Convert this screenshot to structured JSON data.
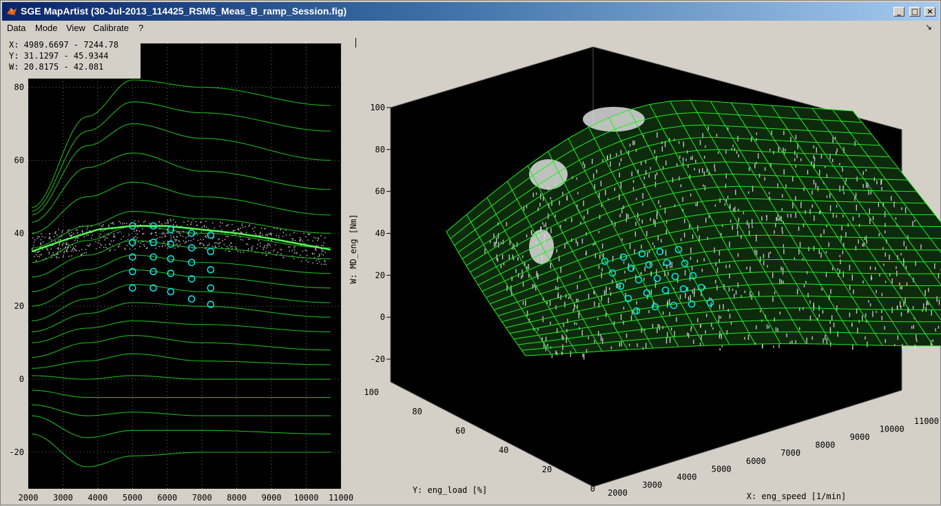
{
  "window": {
    "title": "SGE MapArtist (30-Jul-2013_114425_RSM5_Meas_B_ramp_Session.fig)",
    "buttons": {
      "minimize": "_",
      "maximize": "□",
      "close": "×"
    }
  },
  "menu": [
    "Data",
    "Mode",
    "View",
    "Calibrate",
    "?"
  ],
  "readout": {
    "x": "X: 4989.6697 - 7244.78",
    "y": "Y: 31.1297 - 45.9344",
    "w": "W: 20.8175 - 42.081"
  },
  "colors": {
    "surface": "#22ee22",
    "points": "#ffffff",
    "selection": "#00e5e5",
    "plot_bg": "#000000",
    "window": "#d4d0c8"
  },
  "left_plot": {
    "xticks": [
      "2000",
      "3000",
      "4000",
      "5000",
      "6000",
      "7000",
      "8000",
      "9000",
      "10000",
      "11000"
    ],
    "yticks": [
      "-20",
      "0",
      "20",
      "40",
      "60",
      "80"
    ]
  },
  "right_plot": {
    "zticks": [
      "100",
      "80",
      "60",
      "40",
      "20",
      "0",
      "-20"
    ],
    "yticks": [
      "100",
      "80",
      "60",
      "40",
      "20",
      "0"
    ],
    "xticks": [
      "2000",
      "3000",
      "4000",
      "5000",
      "6000",
      "7000",
      "8000",
      "9000",
      "10000",
      "11000"
    ],
    "zlabel": "W: MD_eng [Nm]",
    "ylabel": "Y: eng_load [%]",
    "xlabel": "X: eng_speed [1/min]"
  },
  "chart_data": [
    {
      "type": "line",
      "title": "",
      "xlabel": "",
      "ylabel": "",
      "xlim": [
        2000,
        11000
      ],
      "ylim": [
        -30,
        92
      ],
      "x": [
        2100,
        3700,
        5000,
        7000,
        10700
      ],
      "series": [
        {
          "values": [
            -15,
            -24,
            -21,
            -20,
            -20
          ]
        },
        {
          "values": [
            -10,
            -16,
            -14,
            -14,
            -15
          ]
        },
        {
          "values": [
            -7,
            -10,
            -9,
            -10,
            -10
          ]
        },
        {
          "values": [
            -3,
            -5,
            -5,
            -5,
            -5
          ]
        },
        {
          "values": [
            1,
            0,
            1,
            0,
            0
          ]
        },
        {
          "values": [
            3,
            5,
            7,
            5,
            4
          ]
        },
        {
          "values": [
            6,
            10,
            12,
            10,
            8
          ]
        },
        {
          "values": [
            10,
            14,
            16,
            15,
            13
          ]
        },
        {
          "values": [
            13,
            18,
            21,
            20,
            17
          ]
        },
        {
          "values": [
            16,
            22,
            26,
            24,
            21
          ]
        },
        {
          "values": [
            20,
            26,
            30,
            28,
            25
          ]
        },
        {
          "values": [
            24,
            30,
            34,
            32,
            29
          ]
        },
        {
          "values": [
            28,
            34,
            38,
            36,
            33
          ]
        },
        {
          "values": [
            32,
            38,
            42,
            40,
            36
          ]
        },
        {
          "values": [
            36,
            42,
            46,
            44,
            40
          ]
        },
        {
          "values": [
            40,
            50,
            54,
            50,
            45
          ]
        },
        {
          "values": [
            43,
            58,
            62,
            57,
            52
          ]
        },
        {
          "values": [
            45,
            64,
            70,
            66,
            60
          ]
        },
        {
          "values": [
            46,
            68,
            76,
            73,
            68
          ]
        },
        {
          "values": [
            47,
            72,
            82,
            80,
            75
          ]
        }
      ],
      "highlight_line": {
        "x": [
          2100,
          3000,
          4000,
          5000,
          6000,
          7000,
          8000,
          9000,
          10700
        ],
        "values": [
          35,
          38,
          41,
          42,
          42,
          41,
          40,
          38.5,
          35.5
        ]
      },
      "selected_points": {
        "x": [
          5000,
          5000,
          5000,
          5000,
          5000,
          5600,
          5600,
          5600,
          5600,
          5600,
          6100,
          6100,
          6100,
          6100,
          6100,
          6700,
          6700,
          6700,
          6700,
          6700,
          7250,
          7250,
          7250,
          7250,
          7250
        ],
        "y": [
          42,
          37.5,
          33.5,
          29.5,
          25,
          42,
          37.5,
          33.5,
          29.5,
          25,
          41,
          37,
          33,
          29,
          24,
          40,
          36,
          32,
          27.5,
          22,
          39.5,
          35,
          30,
          25,
          20.5
        ]
      }
    },
    {
      "type": "surface",
      "title": "",
      "xlabel": "X: eng_speed [1/min]",
      "ylabel": "Y: eng_load [%]",
      "zlabel": "W: MD_eng [Nm]",
      "xlim": [
        2000,
        11000
      ],
      "ylim": [
        0,
        100
      ],
      "zlim": [
        -20,
        100
      ]
    }
  ]
}
